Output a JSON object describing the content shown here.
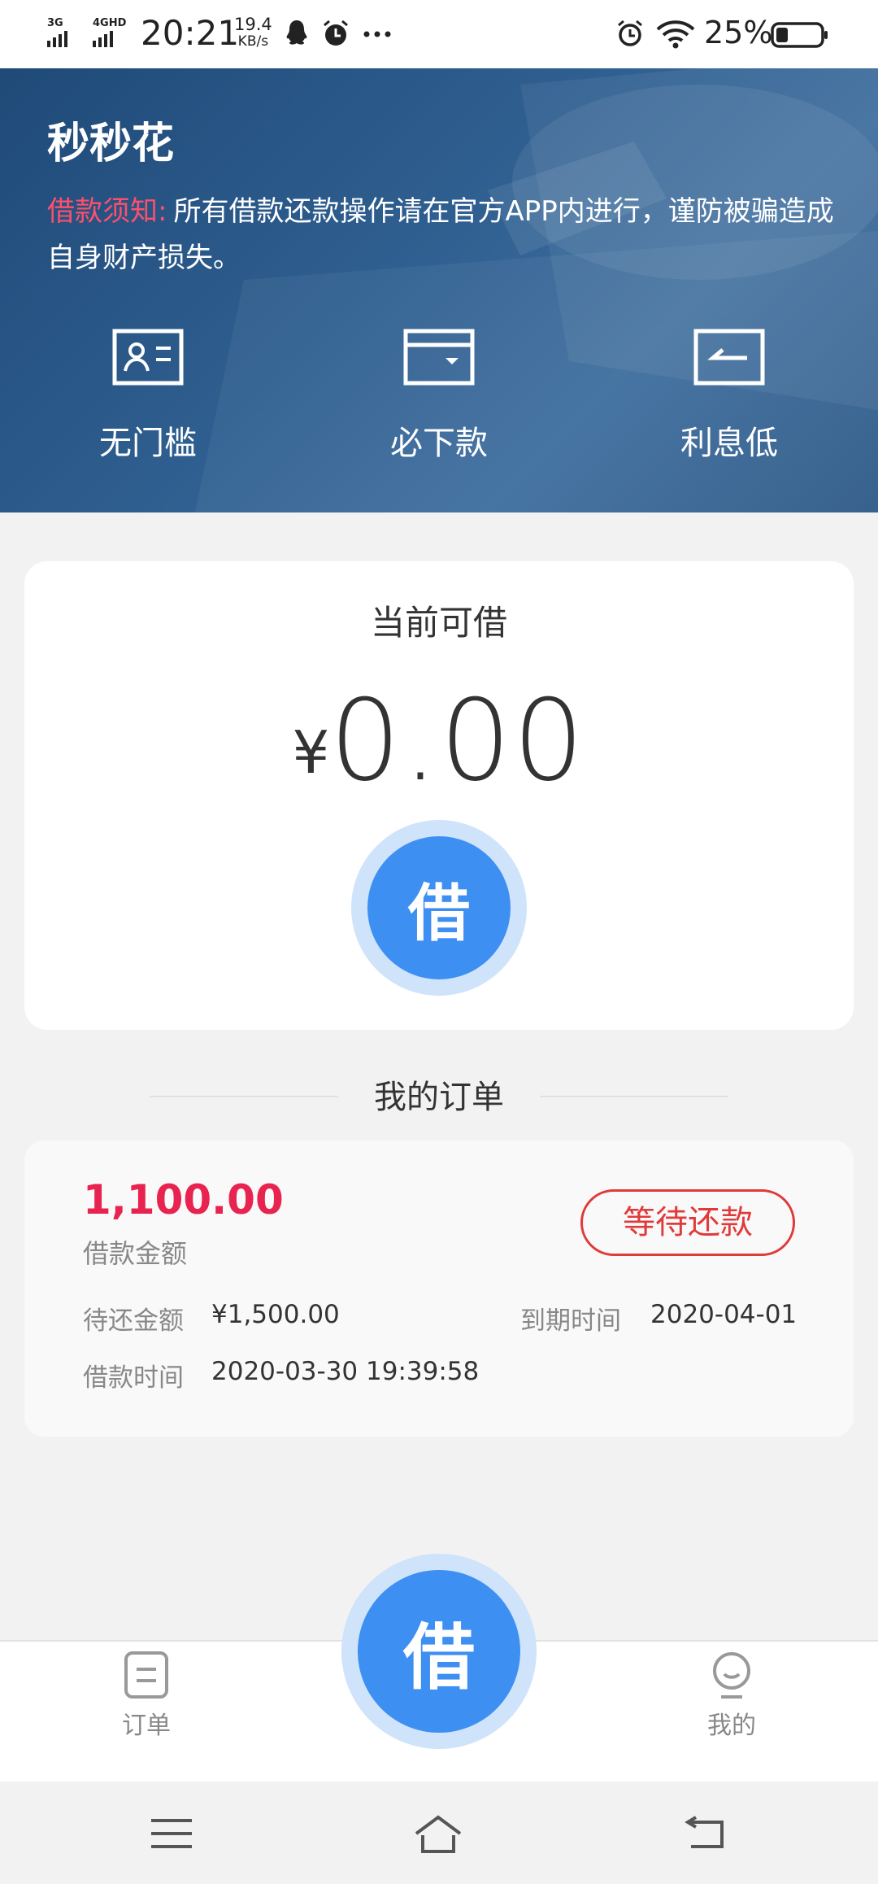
{
  "status_bar": {
    "network_1": "3G",
    "network_2": "4GHD",
    "time": "20:21",
    "speed_value": "19.4",
    "speed_unit": "KB/s",
    "battery": "25%",
    "icons": [
      "qq-icon",
      "alarm-icon",
      "more-icon",
      "alarm-icon",
      "wifi-icon",
      "battery-icon"
    ]
  },
  "header": {
    "app_title": "秒秒花",
    "notice_label": "借款须知:",
    "notice_text": "所有借款还款操作请在官方APP内进行，谨防被骗造成自身财产损失。",
    "features": [
      {
        "label": "无门槛",
        "icon": "id-card-icon"
      },
      {
        "label": "必下款",
        "icon": "wallet-icon"
      },
      {
        "label": "利息低",
        "icon": "low-rate-icon"
      }
    ]
  },
  "balance": {
    "title": "当前可借",
    "currency": "¥",
    "amount": "0.00",
    "button_label": "借"
  },
  "orders": {
    "section_title": "我的订单",
    "items": [
      {
        "amount": "1,100.00",
        "amount_label": "借款金额",
        "status": "等待还款",
        "repay_label": "待还金额",
        "repay_value": "¥1,500.00",
        "due_label": "到期时间",
        "due_value": "2020-04-01",
        "borrow_time_label": "借款时间",
        "borrow_time_value": "2020-03-30 19:39:58"
      }
    ]
  },
  "tab_bar": {
    "tab_orders": "订单",
    "center_button": "借",
    "tab_mine": "我的"
  },
  "colors": {
    "accent_blue": "#3d8ff2",
    "accent_blue_light": "#cfe3fb",
    "amount_red": "#e8234f",
    "status_red": "#e03a3a",
    "notice_pink": "#ff4f6d",
    "banner_blue": "#2f5f90"
  }
}
